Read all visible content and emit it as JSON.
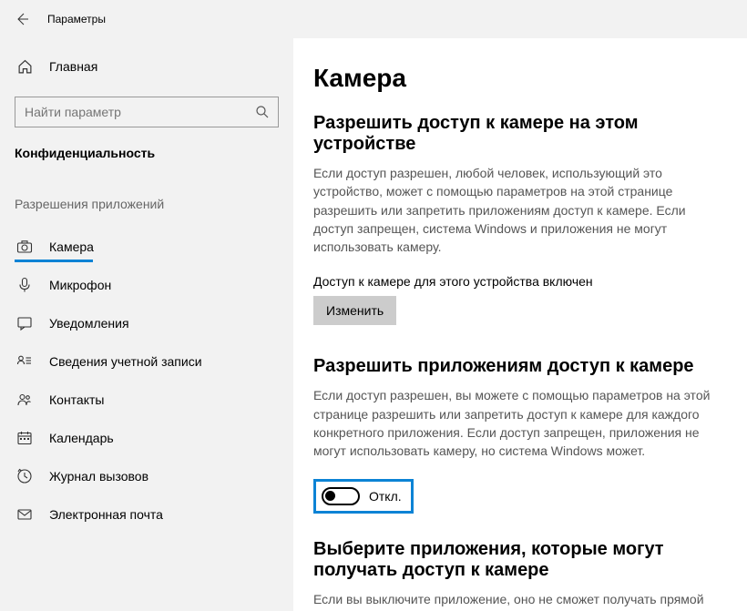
{
  "header": {
    "title": "Параметры"
  },
  "sidebar": {
    "home_label": "Главная",
    "search_placeholder": "Найти параметр",
    "category": "Конфиденциальность",
    "section_label": "Разрешения приложений",
    "items": [
      {
        "label": "Камера"
      },
      {
        "label": "Микрофон"
      },
      {
        "label": "Уведомления"
      },
      {
        "label": "Сведения учетной записи"
      },
      {
        "label": "Контакты"
      },
      {
        "label": "Календарь"
      },
      {
        "label": "Журнал вызовов"
      },
      {
        "label": "Электронная почта"
      }
    ]
  },
  "main": {
    "title": "Камера",
    "section1": {
      "title": "Разрешить доступ к камере на этом устройстве",
      "desc": "Если доступ разрешен, любой человек, использующий это устройство, может с помощью параметров на этой странице разрешить или запретить приложениям доступ к камере. Если доступ запрещен, система Windows и приложения не могут использовать камеру.",
      "status": "Доступ к камере для этого устройства включен",
      "button": "Изменить"
    },
    "section2": {
      "title": "Разрешить приложениям доступ к камере",
      "desc": "Если доступ разрешен, вы можете с помощью параметров на этой странице разрешить или запретить доступ к камере для каждого конкретного приложения. Если доступ запрещен, приложения не могут использовать камеру, но система Windows может.",
      "toggle_label": "Откл."
    },
    "section3": {
      "title": "Выберите приложения, которые могут получать доступ к камере",
      "desc": "Если вы выключите приложение, оно не сможет получать прямой"
    }
  }
}
